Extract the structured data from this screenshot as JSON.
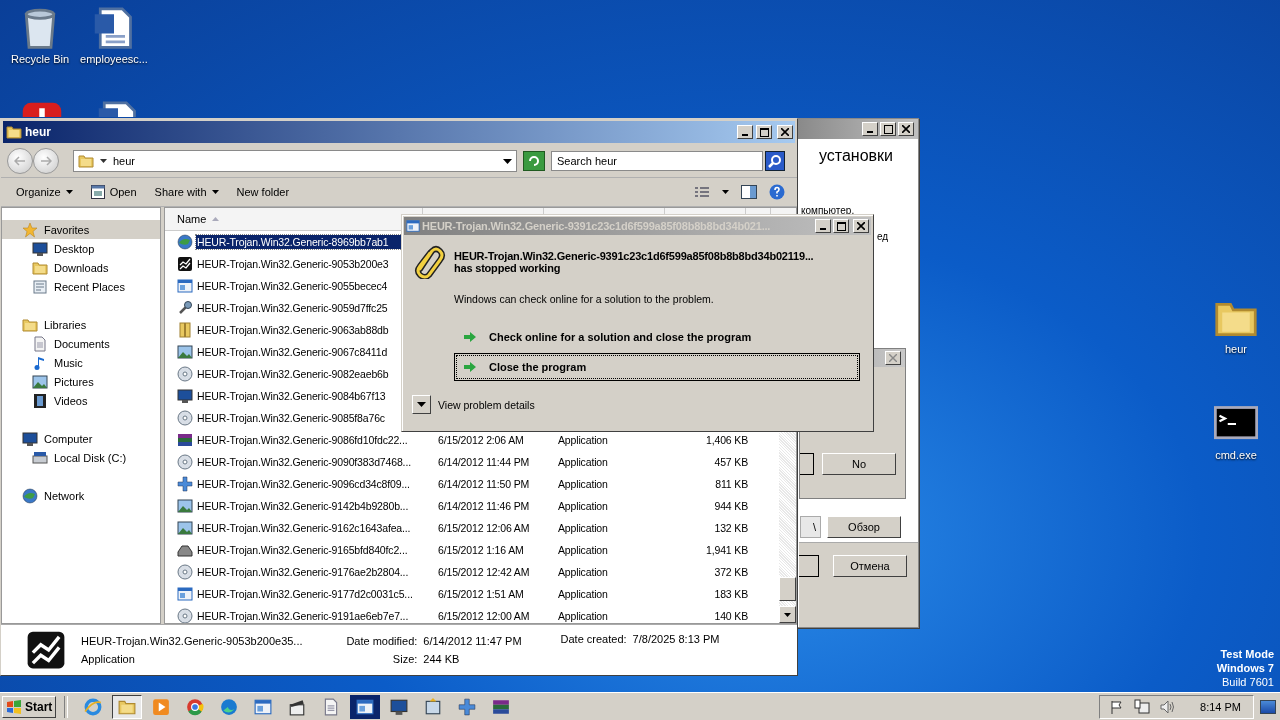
{
  "desktop": {
    "icons": [
      {
        "label": "Recycle Bin",
        "kind": "recycle"
      },
      {
        "label": "employeesc...",
        "kind": "word"
      },
      {
        "kind": "red"
      },
      {
        "kind": "word"
      },
      {
        "label": "heur",
        "kind": "folder"
      },
      {
        "label": "cmd.exe",
        "kind": "cmd"
      }
    ],
    "os_notice": [
      "Test Mode",
      "Windows 7",
      "Build 7601"
    ]
  },
  "installer": {
    "heading": "установки",
    "lines": [
      "компьютер.",
      "ед"
    ],
    "prompt_button": "No",
    "path_fragment": "\\",
    "browse_button": "Обзор",
    "cancel_button": "Отмена"
  },
  "explorer": {
    "title": "heur",
    "address": "heur",
    "search": {
      "placeholder": "Search heur"
    },
    "toolbar": [
      {
        "label": "Organize",
        "kind": "menu"
      },
      {
        "label": "Open",
        "kind": "open"
      },
      {
        "label": "Share with",
        "kind": "menu"
      },
      {
        "label": "New folder",
        "kind": "plain"
      }
    ],
    "sidebar": [
      {
        "label": "Favorites",
        "kind": "star",
        "selected": true,
        "children": [
          {
            "label": "Desktop",
            "kind": "desktop",
            "selected": false
          },
          {
            "label": "Downloads",
            "kind": "downloads",
            "selected": false
          },
          {
            "label": "Recent Places",
            "kind": "recent",
            "selected": false
          }
        ]
      },
      {
        "label": "Libraries",
        "kind": "library",
        "selected": false,
        "children": [
          {
            "label": "Documents",
            "kind": "documents",
            "selected": false
          },
          {
            "label": "Music",
            "kind": "music",
            "selected": false
          },
          {
            "label": "Pictures",
            "kind": "pictures",
            "selected": false
          },
          {
            "label": "Videos",
            "kind": "videos",
            "selected": false
          }
        ]
      },
      {
        "label": "Computer",
        "kind": "computer",
        "selected": false,
        "children": [
          {
            "label": "Local Disk (C:)",
            "kind": "drive",
            "selected": false
          }
        ]
      },
      {
        "label": "Network",
        "kind": "network",
        "selected": false
      }
    ],
    "list": {
      "sort_column": "Name",
      "rows": [
        {
          "name": "HEUR-Trojan.Win32.Generic-8969bb7ab1",
          "kind": "globe",
          "selected": true
        },
        {
          "name": "HEUR-Trojan.Win32.Generic-9053b200e3",
          "kind": "chart",
          "selected": false
        },
        {
          "name": "HEUR-Trojan.Win32.Generic-9055becec4",
          "kind": "window",
          "selected": false
        },
        {
          "name": "HEUR-Trojan.Win32.Generic-9059d7ffc25",
          "kind": "tool",
          "selected": false
        },
        {
          "name": "HEUR-Trojan.Win32.Generic-9063ab88db",
          "kind": "binder",
          "selected": false
        },
        {
          "name": "HEUR-Trojan.Win32.Generic-9067c8411d",
          "kind": "photo",
          "selected": false
        },
        {
          "name": "HEUR-Trojan.Win32.Generic-9082eaeb6b",
          "kind": "disc",
          "selected": false
        },
        {
          "name": "HEUR-Trojan.Win32.Generic-9084b67f13",
          "kind": "monitor",
          "selected": false
        },
        {
          "name": "HEUR-Trojan.Win32.Generic-9085f8a76c",
          "kind": "cd",
          "selected": false
        },
        {
          "name": "HEUR-Trojan.Win32.Generic-9086fd10fdc22...",
          "date": "6/15/2012 2:06 AM",
          "type": "Application",
          "size": "1,406 KB",
          "kind": "books",
          "selected": false
        },
        {
          "name": "HEUR-Trojan.Win32.Generic-9090f383d7468...",
          "date": "6/14/2012 11:44 PM",
          "type": "Application",
          "size": "457 KB",
          "kind": "cd",
          "selected": false
        },
        {
          "name": "HEUR-Trojan.Win32.Generic-9096cd34c8f09...",
          "date": "6/14/2012 11:50 PM",
          "type": "Application",
          "size": "811 KB",
          "kind": "plus",
          "selected": false
        },
        {
          "name": "HEUR-Trojan.Win32.Generic-9142b4b9280b...",
          "date": "6/14/2012 11:46 PM",
          "type": "Application",
          "size": "944 KB",
          "kind": "landscape",
          "selected": false
        },
        {
          "name": "HEUR-Trojan.Win32.Generic-9162c1643afea...",
          "date": "6/15/2012 12:06 AM",
          "type": "Application",
          "size": "132 KB",
          "kind": "photo",
          "selected": false
        },
        {
          "name": "HEUR-Trojan.Win32.Generic-9165bfd840fc2...",
          "date": "6/15/2012 1:16 AM",
          "type": "Application",
          "size": "1,941 KB",
          "kind": "tray",
          "selected": false
        },
        {
          "name": "HEUR-Trojan.Win32.Generic-9176ae2b2804...",
          "date": "6/15/2012 12:42 AM",
          "type": "Application",
          "size": "372 KB",
          "kind": "disc",
          "selected": false
        },
        {
          "name": "HEUR-Trojan.Win32.Generic-9177d2c0031c5...",
          "date": "6/15/2012 1:51 AM",
          "type": "Application",
          "size": "183 KB",
          "kind": "window",
          "selected": false
        },
        {
          "name": "HEUR-Trojan.Win32.Generic-9191ae6eb7e7...",
          "date": "6/15/2012 12:00 AM",
          "type": "Application",
          "size": "140 KB",
          "kind": "cd",
          "selected": false
        }
      ]
    },
    "details": {
      "kind": "chart",
      "name": "HEUR-Trojan.Win32.Generic-9053b200e35...",
      "type": "Application",
      "fields": [
        {
          "label": "Date modified:",
          "value": "6/14/2012 11:47 PM"
        },
        {
          "label": "Size:",
          "value": "244 KB"
        },
        {
          "label": "Date created:",
          "value": "7/8/2025 8:13 PM"
        }
      ]
    }
  },
  "error_dialog": {
    "title": "HEUR-Trojan.Win32.Generic-9391c23c1d6f599a85f08b8b8bd34b021...",
    "app_name": "HEUR-Trojan.Win32.Generic-9391c23c1d6f599a85f08b8b8bd34b02119...",
    "status": "has stopped working",
    "message": "Windows can check online for a solution to the problem.",
    "options": [
      {
        "label": "Check online for a solution and close the program",
        "selected": false
      },
      {
        "label": "Close the program",
        "selected": true
      }
    ],
    "details_toggle": "View problem details"
  },
  "taskbar": {
    "start": "Start",
    "items": [
      {
        "kind": "ie",
        "selected": false
      },
      {
        "kind": "folder",
        "selected": true
      },
      {
        "kind": "media",
        "selected": false
      },
      {
        "kind": "chrome",
        "selected": false
      },
      {
        "kind": "edge",
        "selected": false
      },
      {
        "kind": "window",
        "selected": false
      },
      {
        "kind": "clapper",
        "selected": false
      },
      {
        "kind": "file",
        "selected": false
      },
      {
        "kind": "wer",
        "selected": false
      },
      {
        "kind": "setup",
        "selected": false
      },
      {
        "kind": "installer",
        "selected": false
      },
      {
        "kind": "plus",
        "selected": false
      },
      {
        "kind": "books",
        "selected": false
      }
    ],
    "clock": "8:14 PM"
  }
}
